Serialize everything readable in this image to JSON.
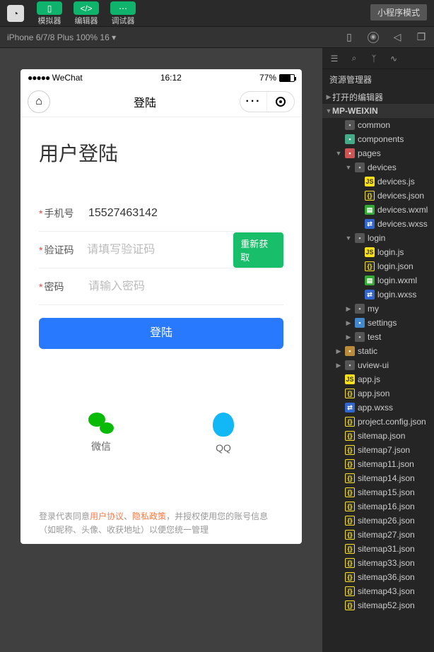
{
  "toolbar": {
    "tabs": [
      "模拟器",
      "编辑器",
      "调试器"
    ],
    "mode": "小程序模式"
  },
  "devbar": {
    "device": "iPhone 6/7/8 Plus 100% 16",
    "arrow": "▾"
  },
  "sidepanel": {
    "title": "资源管理器",
    "section1": "打开的编辑器",
    "project": "MP-WEIXIN",
    "tree": [
      {
        "d": 1,
        "a": "",
        "i": "folder",
        "t": "common"
      },
      {
        "d": 1,
        "a": "",
        "i": "folder-g",
        "t": "components"
      },
      {
        "d": 1,
        "a": "v",
        "i": "folder-r",
        "t": "pages"
      },
      {
        "d": 2,
        "a": "v",
        "i": "folder",
        "t": "devices"
      },
      {
        "d": 3,
        "a": "",
        "i": "js",
        "t": "devices.js"
      },
      {
        "d": 3,
        "a": "",
        "i": "json",
        "t": "devices.json"
      },
      {
        "d": 3,
        "a": "",
        "i": "wxml",
        "t": "devices.wxml"
      },
      {
        "d": 3,
        "a": "",
        "i": "wxss",
        "t": "devices.wxss"
      },
      {
        "d": 2,
        "a": "v",
        "i": "folder",
        "t": "login"
      },
      {
        "d": 3,
        "a": "",
        "i": "js",
        "t": "login.js"
      },
      {
        "d": 3,
        "a": "",
        "i": "json",
        "t": "login.json"
      },
      {
        "d": 3,
        "a": "",
        "i": "wxml",
        "t": "login.wxml"
      },
      {
        "d": 3,
        "a": "",
        "i": "wxss",
        "t": "login.wxss"
      },
      {
        "d": 2,
        "a": ">",
        "i": "folder",
        "t": "my"
      },
      {
        "d": 2,
        "a": ">",
        "i": "folder-b",
        "t": "settings"
      },
      {
        "d": 2,
        "a": ">",
        "i": "folder",
        "t": "test"
      },
      {
        "d": 1,
        "a": ">",
        "i": "folder-o",
        "t": "static"
      },
      {
        "d": 1,
        "a": ">",
        "i": "folder",
        "t": "uview-ui"
      },
      {
        "d": 1,
        "a": "",
        "i": "js",
        "t": "app.js"
      },
      {
        "d": 1,
        "a": "",
        "i": "json",
        "t": "app.json"
      },
      {
        "d": 1,
        "a": "",
        "i": "wxss",
        "t": "app.wxss"
      },
      {
        "d": 1,
        "a": "",
        "i": "json",
        "t": "project.config.json"
      },
      {
        "d": 1,
        "a": "",
        "i": "json",
        "t": "sitemap.json"
      },
      {
        "d": 1,
        "a": "",
        "i": "json",
        "t": "sitemap7.json"
      },
      {
        "d": 1,
        "a": "",
        "i": "json",
        "t": "sitemap11.json"
      },
      {
        "d": 1,
        "a": "",
        "i": "json",
        "t": "sitemap14.json"
      },
      {
        "d": 1,
        "a": "",
        "i": "json",
        "t": "sitemap15.json"
      },
      {
        "d": 1,
        "a": "",
        "i": "json",
        "t": "sitemap16.json"
      },
      {
        "d": 1,
        "a": "",
        "i": "json",
        "t": "sitemap26.json"
      },
      {
        "d": 1,
        "a": "",
        "i": "json",
        "t": "sitemap27.json"
      },
      {
        "d": 1,
        "a": "",
        "i": "json",
        "t": "sitemap31.json"
      },
      {
        "d": 1,
        "a": "",
        "i": "json",
        "t": "sitemap33.json"
      },
      {
        "d": 1,
        "a": "",
        "i": "json",
        "t": "sitemap36.json"
      },
      {
        "d": 1,
        "a": "",
        "i": "json",
        "t": "sitemap43.json"
      },
      {
        "d": 1,
        "a": "",
        "i": "json",
        "t": "sitemap52.json"
      }
    ]
  },
  "phone": {
    "status": {
      "carrier": "WeChat",
      "time": "16:12",
      "battery": "77%"
    },
    "nav": {
      "title": "登陆"
    },
    "page": {
      "title": "用户登陆",
      "fields": {
        "phone": {
          "label": "手机号",
          "value": "15527463142"
        },
        "code": {
          "label": "验证码",
          "placeholder": "请填写验证码",
          "btn": "重新获取"
        },
        "pwd": {
          "label": "密码",
          "placeholder": "请输入密码"
        }
      },
      "login_btn": "登陆",
      "social": {
        "wechat": "微信",
        "qq": "QQ"
      },
      "agreement": {
        "p1": "登录代表同意",
        "a1": "用户协议",
        "sep": "、",
        "a2": "隐私政策",
        "p2": "，并授权使用您的账号信息（如昵称、头像、收获地址）以便您统一管理"
      }
    }
  }
}
